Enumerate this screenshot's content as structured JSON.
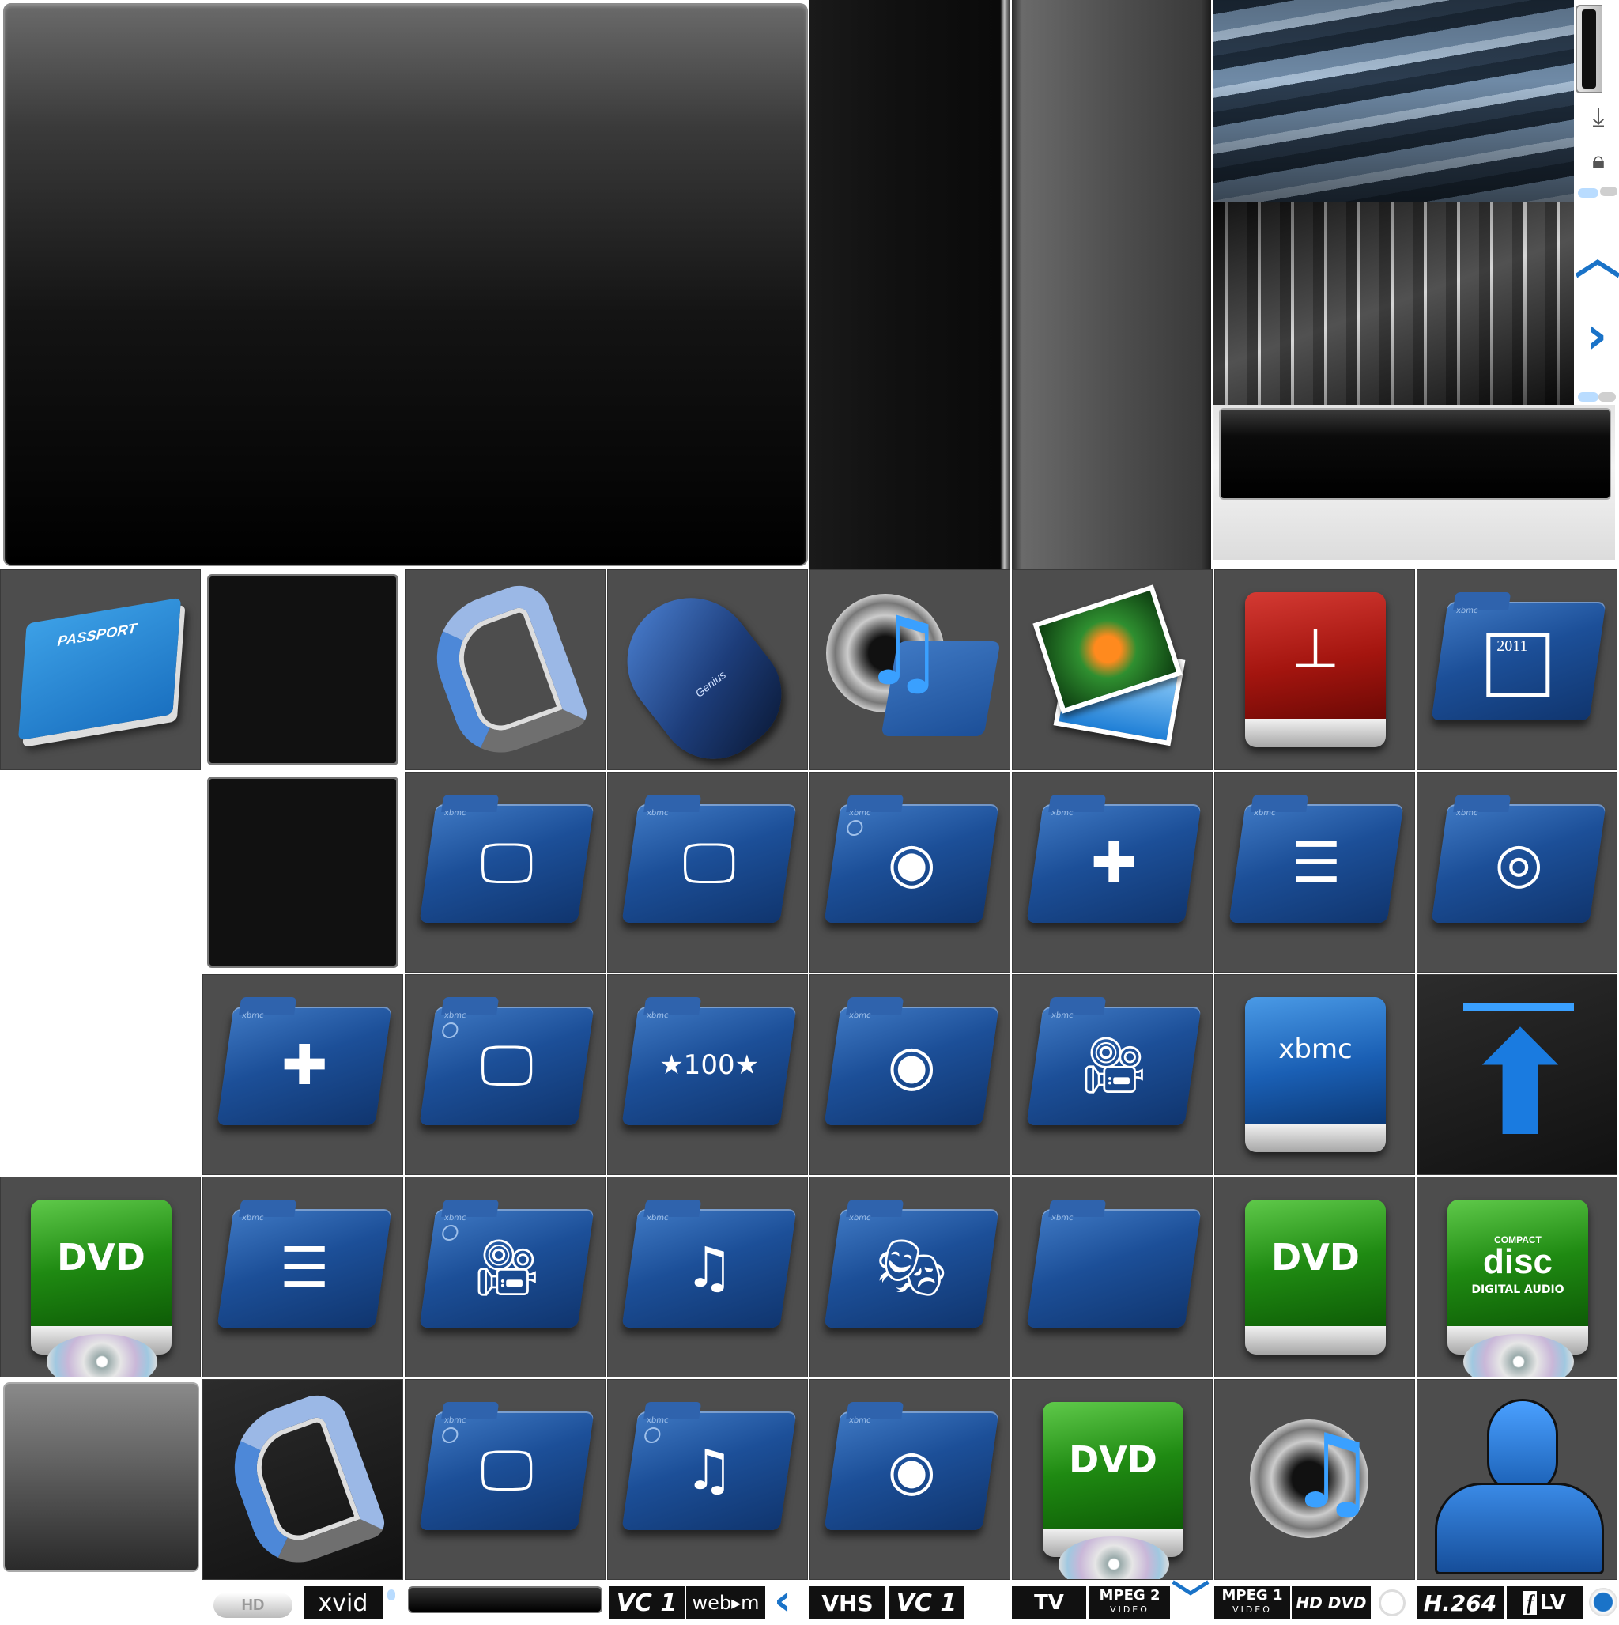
{
  "tiles": {
    "passport": {
      "text": "PASSPORT"
    },
    "xbmc_drive": {
      "text": "xbmc"
    },
    "year_folder": {
      "text": "2011"
    },
    "top100_folder": {
      "text": "★100★"
    },
    "folder_brand": "xbmc"
  },
  "drives": {
    "dvd": {
      "label": "DVD"
    },
    "compact_disc": {
      "line1": "COMPACT",
      "line2": "disc",
      "line3": "DIGITAL AUDIO"
    }
  },
  "mouse": {
    "brand": "Genius"
  },
  "flags": {
    "hd": "HD",
    "xvid": "xvid",
    "vc1_a": "VC 1",
    "webm": "web▸m",
    "vhs": "VHS",
    "vc1_b": "VC 1",
    "tv": "TV",
    "mpeg2": "MPEG 2",
    "mpeg2_sub": "VIDEO",
    "mpeg1": "MPEG 1",
    "mpeg1_sub": "VIDEO",
    "hddvd": "HD DVD",
    "h264": "H.264",
    "flv": "LV"
  },
  "icons": {
    "side_download": "download-icon",
    "side_lock": "lock-icon",
    "chevron_up": "chevron-up-icon",
    "chevron_right": "chevron-right-icon",
    "chevron_left": "chevron-left-icon",
    "chevron_down": "chevron-down-icon",
    "arrow_up": "arrow-up-icon",
    "user": "user-silhouette-icon"
  },
  "colors": {
    "accent_blue": "#1a73c8",
    "folder_blue": "#1c4f98",
    "drive_green": "#1f8a12",
    "drive_red": "#a4150f",
    "tile_bg": "#4d4d4d"
  }
}
